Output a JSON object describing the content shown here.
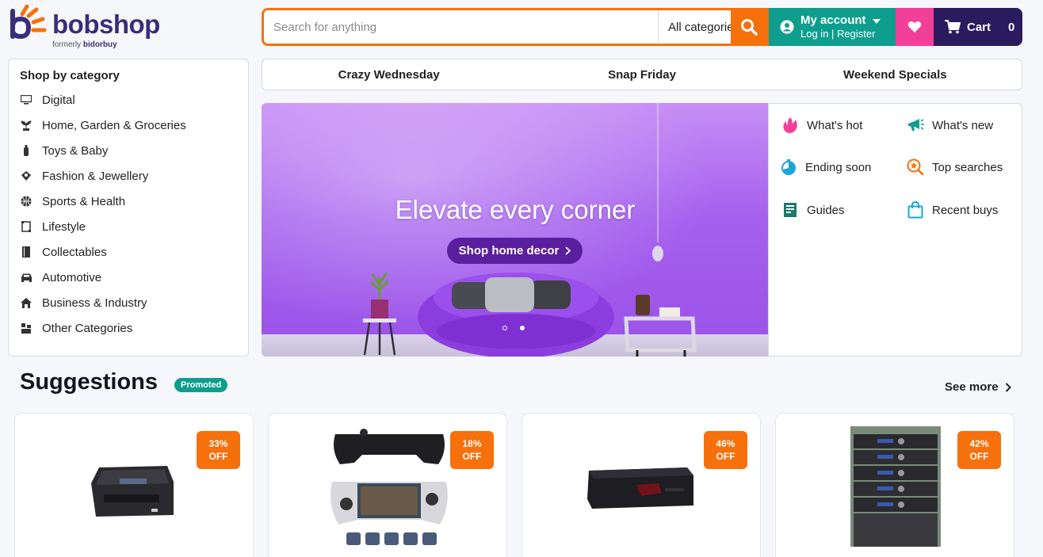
{
  "brand": {
    "name": "bobshop",
    "formerly_prefix": "formerly",
    "formerly_name": "bidorbuy"
  },
  "search": {
    "placeholder": "Search for anything",
    "category": "All categories"
  },
  "account": {
    "title": "My account",
    "login": "Log in",
    "separator": "|",
    "register": "Register"
  },
  "cart": {
    "label": "Cart",
    "count": "0"
  },
  "sidebar": {
    "title": "Shop by category",
    "items": [
      {
        "label": "Digital",
        "icon": "monitor-icon"
      },
      {
        "label": "Home, Garden & Groceries",
        "icon": "plant-icon"
      },
      {
        "label": "Toys & Baby",
        "icon": "bottle-icon"
      },
      {
        "label": "Fashion & Jewellery",
        "icon": "gem-icon"
      },
      {
        "label": "Sports & Health",
        "icon": "ball-icon"
      },
      {
        "label": "Lifestyle",
        "icon": "frame-icon"
      },
      {
        "label": "Collectables",
        "icon": "book-icon"
      },
      {
        "label": "Automotive",
        "icon": "car-icon"
      },
      {
        "label": "Business & Industry",
        "icon": "building-icon"
      },
      {
        "label": "Other Categories",
        "icon": "boxes-icon"
      }
    ]
  },
  "promos": [
    "Crazy Wednesday",
    "Snap Friday",
    "Weekend Specials"
  ],
  "banner": {
    "headline": "Elevate every corner",
    "cta": "Shop home decor"
  },
  "quick_links": [
    {
      "label": "What's hot",
      "icon": "flame-icon"
    },
    {
      "label": "What's new",
      "icon": "megaphone-icon"
    },
    {
      "label": "Ending soon",
      "icon": "timer-icon"
    },
    {
      "label": "Top searches",
      "icon": "search-star-icon"
    },
    {
      "label": "Guides",
      "icon": "guide-book-icon"
    },
    {
      "label": "Recent buys",
      "icon": "shopping-bag-icon"
    }
  ],
  "suggestions": {
    "title": "Suggestions",
    "badge": "Promoted",
    "see_more": "See more",
    "products": [
      {
        "discount": "33%",
        "off": "OFF"
      },
      {
        "discount": "18%",
        "off": "OFF"
      },
      {
        "discount": "46%",
        "off": "OFF"
      },
      {
        "discount": "42%",
        "off": "OFF"
      }
    ]
  },
  "colors": {
    "orange": "#f6700c",
    "teal": "#0f9e8e",
    "pink": "#f23f98",
    "navy": "#2a1a5e",
    "purple": "#3a2d7a"
  }
}
